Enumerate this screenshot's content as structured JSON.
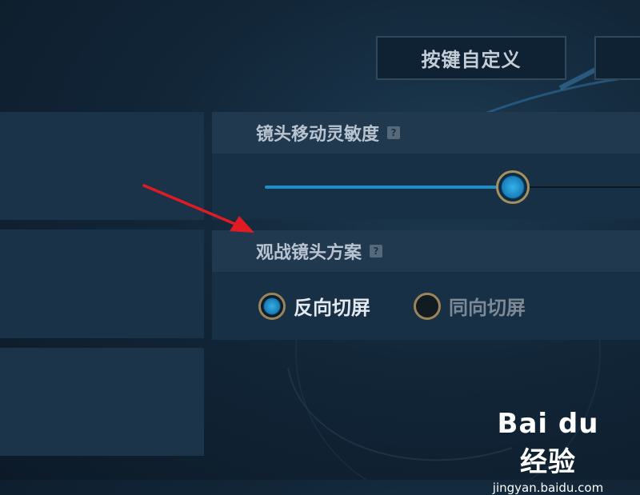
{
  "header": {
    "key_custom_label": "按键自定义"
  },
  "camera_sensitivity": {
    "title": "镜头移动灵敏度",
    "help": "?",
    "value_fraction": 0.66
  },
  "spectator_camera": {
    "title": "观战镜头方案",
    "help": "?",
    "options": [
      {
        "label": "反向切屏",
        "selected": true
      },
      {
        "label": "同向切屏",
        "selected": false
      }
    ]
  },
  "watermark": {
    "logo": "Bai du 经验",
    "url": "jingyan.baidu.com"
  },
  "colors": {
    "accent": "#1e8ec4",
    "gold_border": "#a8905c",
    "annotation_arrow": "#e01b24"
  }
}
